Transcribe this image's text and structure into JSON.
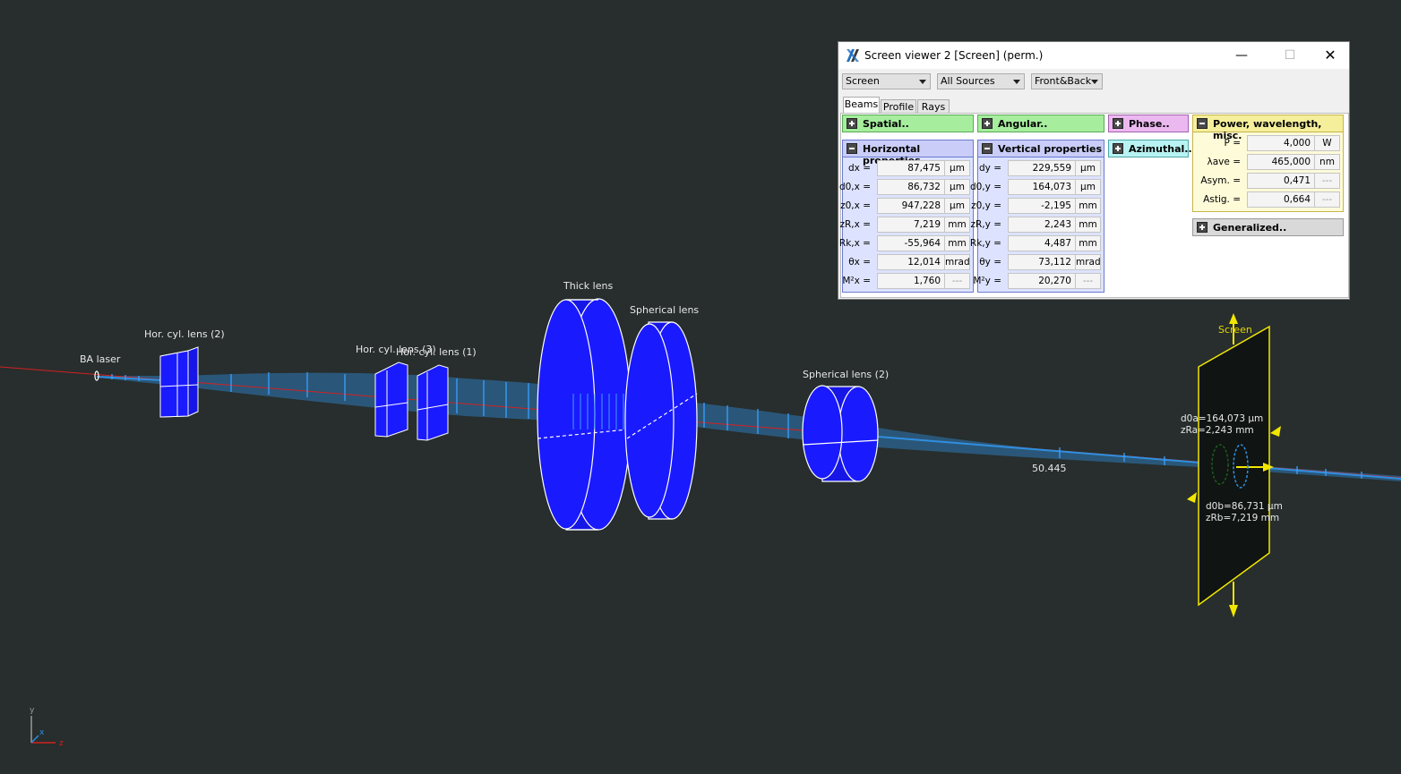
{
  "scene": {
    "labels": {
      "ba_laser": "BA laser",
      "hor_cyl_lens_2": "Hor. cyl. lens (2)",
      "hor_cyl_lens_3": "Hor. cyl. lens (3)",
      "hor_cyl_lens_1": "Hor. cyl. lens (1)",
      "thick_lens": "Thick lens",
      "spherical_lens": "Spherical lens",
      "spherical_lens_2": "Spherical lens (2)",
      "screen": "Screen",
      "distance": "50.445"
    },
    "screen_info": {
      "d0a": "d0a=164,073 µm",
      "zra": "zRa=2,243 mm",
      "d0b": "d0b=86,731 µm",
      "zrb": "zRb=7,219 mm"
    },
    "axes": {
      "y": "y",
      "x": "x",
      "z": "z"
    },
    "colors": {
      "background": "#272e2d",
      "element": "#1616e6",
      "beam": "#2e8fe0",
      "axis_line": "#d42020",
      "screen_outline": "#f2e600"
    }
  },
  "window": {
    "title": "Screen viewer 2 [Screen] (perm.)",
    "controls": {
      "minimize": "—",
      "maximize": "☐",
      "close": "✕"
    },
    "combos": [
      "Screen",
      "All Sources",
      "Front&Back"
    ],
    "tabs": [
      "Beams",
      "Profile",
      "Rays"
    ],
    "sections": {
      "spatial": "Spatial..",
      "angular": "Angular..",
      "phase": "Phase..",
      "power": "Power, wavelength, misc.",
      "horizontal": "Horizontal properties",
      "vertical": "Vertical properties",
      "azimuthal": "Azimuthal..",
      "generalized": "Generalized.."
    },
    "horizontal": [
      {
        "label": "dx =",
        "value": "87,475",
        "unit": "µm"
      },
      {
        "label": "d0,x =",
        "value": "86,732",
        "unit": "µm"
      },
      {
        "label": "z0,x =",
        "value": "947,228",
        "unit": "µm"
      },
      {
        "label": "zR,x =",
        "value": "7,219",
        "unit": "mm"
      },
      {
        "label": "Rk,x =",
        "value": "-55,964",
        "unit": "mm"
      },
      {
        "label": "θx =",
        "value": "12,014",
        "unit": "mrad"
      },
      {
        "label": "M²x =",
        "value": "1,760",
        "unit": "---"
      }
    ],
    "vertical": [
      {
        "label": "dy =",
        "value": "229,559",
        "unit": "µm"
      },
      {
        "label": "d0,y =",
        "value": "164,073",
        "unit": "µm"
      },
      {
        "label": "z0,y =",
        "value": "-2,195",
        "unit": "mm"
      },
      {
        "label": "zR,y =",
        "value": "2,243",
        "unit": "mm"
      },
      {
        "label": "Rk,y =",
        "value": "4,487",
        "unit": "mm"
      },
      {
        "label": "θy =",
        "value": "73,112",
        "unit": "mrad"
      },
      {
        "label": "M²y =",
        "value": "20,270",
        "unit": "---"
      }
    ],
    "power": [
      {
        "label": "P =",
        "value": "4,000",
        "unit": "W"
      },
      {
        "label": "λave =",
        "value": "465,000",
        "unit": "nm"
      },
      {
        "label": "Asym. =",
        "value": "0,471",
        "unit": "---"
      },
      {
        "label": "Astig. =",
        "value": "0,664",
        "unit": "---"
      }
    ]
  }
}
